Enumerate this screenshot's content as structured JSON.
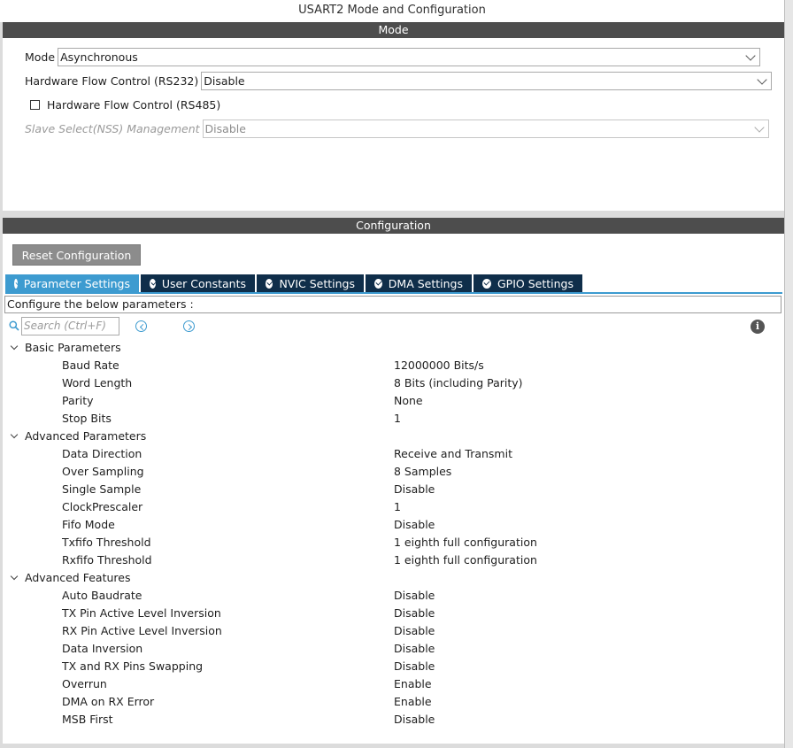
{
  "window": {
    "title": "USART2 Mode and Configuration"
  },
  "mode": {
    "header": "Mode",
    "mode_field": {
      "label": "Mode",
      "value": "Asynchronous"
    },
    "hw_flow_rs232": {
      "label": "Hardware Flow Control (RS232)",
      "value": "Disable"
    },
    "hw_flow_rs485": {
      "label": "Hardware Flow Control (RS485)",
      "checked": false
    },
    "slave_select": {
      "label": "Slave Select(NSS) Management",
      "value": "Disable",
      "enabled": false
    }
  },
  "configuration": {
    "header": "Configuration",
    "reset_label": "Reset Configuration",
    "tabs": [
      {
        "label": "Parameter Settings",
        "active": true
      },
      {
        "label": "User Constants",
        "active": false
      },
      {
        "label": "NVIC Settings",
        "active": false
      },
      {
        "label": "DMA Settings",
        "active": false
      },
      {
        "label": "GPIO Settings",
        "active": false
      }
    ],
    "info_text": "Configure the below parameters :",
    "search_placeholder": "Search (Ctrl+F)",
    "groups": [
      {
        "label": "Basic Parameters",
        "params": [
          {
            "name": "Baud Rate",
            "value": "12000000 Bits/s"
          },
          {
            "name": "Word Length",
            "value": "8 Bits (including Parity)"
          },
          {
            "name": "Parity",
            "value": "None"
          },
          {
            "name": "Stop Bits",
            "value": "1"
          }
        ]
      },
      {
        "label": "Advanced Parameters",
        "params": [
          {
            "name": "Data Direction",
            "value": "Receive and Transmit"
          },
          {
            "name": "Over Sampling",
            "value": "8 Samples"
          },
          {
            "name": "Single Sample",
            "value": "Disable"
          },
          {
            "name": "ClockPrescaler",
            "value": "1"
          },
          {
            "name": "Fifo Mode",
            "value": "Disable"
          },
          {
            "name": "Txfifo Threshold",
            "value": "1 eighth full configuration"
          },
          {
            "name": "Rxfifo Threshold",
            "value": "1 eighth full configuration"
          }
        ]
      },
      {
        "label": "Advanced Features",
        "params": [
          {
            "name": "Auto Baudrate",
            "value": "Disable"
          },
          {
            "name": "TX Pin Active Level Inversion",
            "value": "Disable"
          },
          {
            "name": "RX Pin Active Level Inversion",
            "value": "Disable"
          },
          {
            "name": "Data Inversion",
            "value": "Disable"
          },
          {
            "name": "TX and RX Pins Swapping",
            "value": "Disable"
          },
          {
            "name": "Overrun",
            "value": "Enable"
          },
          {
            "name": "DMA on RX Error",
            "value": "Enable"
          },
          {
            "name": "MSB First",
            "value": "Disable"
          }
        ]
      }
    ]
  },
  "icons": {
    "tab_status": "check-circle-icon",
    "search": "search-icon",
    "prev": "chevron-left-circle-icon",
    "next": "chevron-right-circle-icon",
    "info": "info-icon",
    "dropdown": "chevron-down-icon",
    "group_toggle": "chevron-down-icon"
  },
  "colors": {
    "section_header": "#4d4d4d",
    "tab_inactive": "#0f2e4a",
    "tab_active": "#3d9bd0",
    "reset_button": "#8c8c8c"
  }
}
